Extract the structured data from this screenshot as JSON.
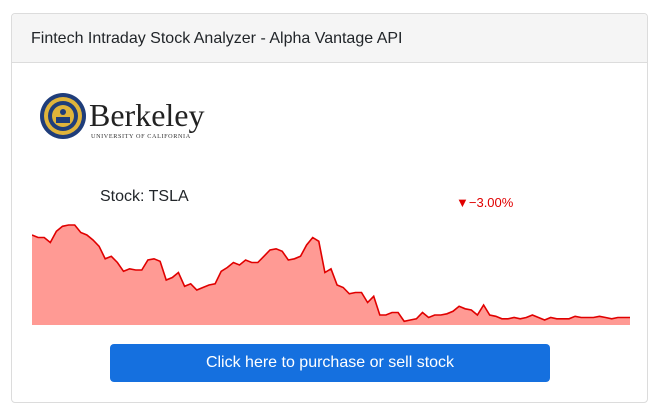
{
  "header": {
    "title": "Fintech Intraday Stock Analyzer - Alpha Vantage API"
  },
  "logo": {
    "wordmark": "Berkeley",
    "subtitle": "UNIVERSITY OF CALIFORNIA"
  },
  "stock": {
    "label": "Stock: TSLA",
    "change": "▼−3.00%"
  },
  "colors": {
    "fill": "#ff9a94",
    "line": "#e00000",
    "button": "#1570df",
    "seal_blue": "#1f3d7a",
    "seal_gold": "#e0b43a"
  },
  "action": {
    "button_label": "Click here to purchase or sell stock"
  },
  "chart_data": {
    "type": "area",
    "values": [
      72,
      70,
      70,
      66,
      75,
      79,
      80,
      80,
      74,
      72,
      68,
      63,
      53,
      55,
      50,
      43,
      45,
      44,
      44,
      52,
      53,
      51,
      36,
      38,
      42,
      31,
      33,
      28,
      30,
      32,
      33,
      43,
      46,
      50,
      48,
      52,
      50,
      50,
      55,
      60,
      61,
      59,
      52,
      53,
      55,
      64,
      70,
      67,
      42,
      45,
      32,
      30,
      25,
      26,
      26,
      18,
      23,
      8,
      8,
      10,
      10,
      3,
      4,
      5,
      10,
      6,
      8,
      8,
      9,
      11,
      15,
      13,
      12,
      8,
      16,
      8,
      7,
      5,
      5,
      6,
      5,
      6,
      8,
      6,
      4,
      6,
      5,
      5,
      5,
      7,
      6,
      6,
      6,
      7,
      6,
      5,
      6,
      6,
      6
    ]
  }
}
